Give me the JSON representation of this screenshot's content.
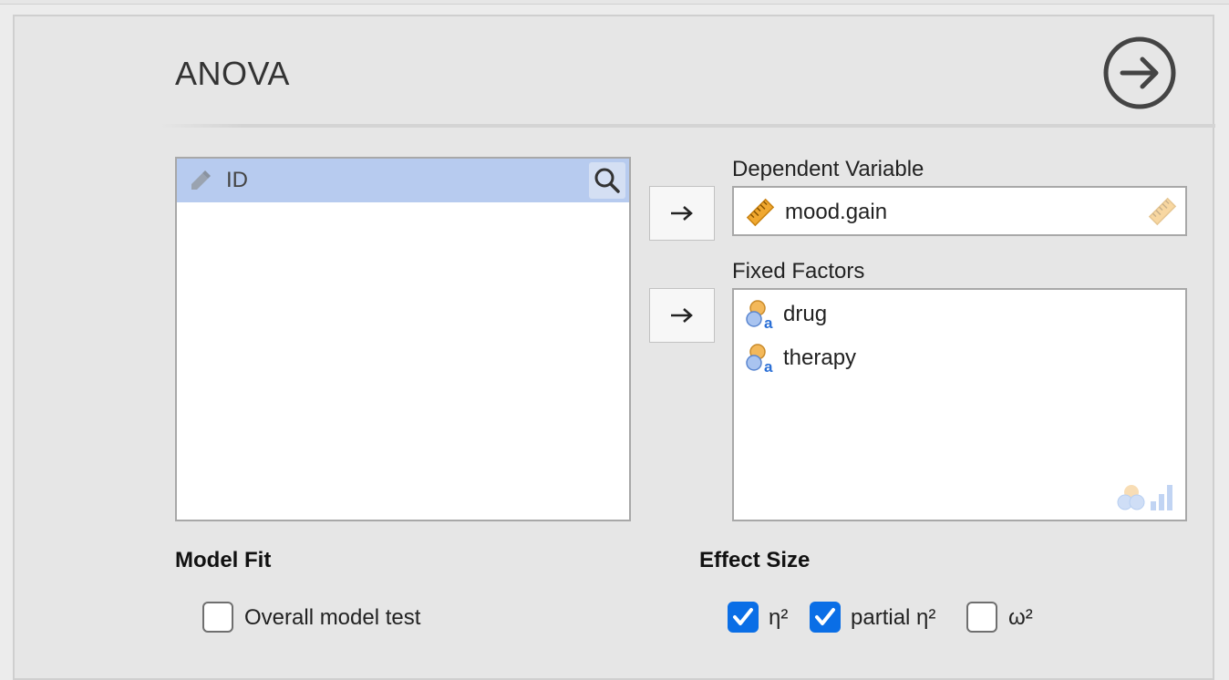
{
  "header": {
    "title": "ANOVA"
  },
  "run_button": {
    "icon": "arrow-right-circle-icon"
  },
  "source_list": {
    "items": [
      {
        "label": "ID",
        "icon": "nominal-id-icon",
        "selected": true
      }
    ],
    "search_icon": "search-icon"
  },
  "dependent_variable": {
    "label": "Dependent Variable",
    "items": [
      {
        "label": "mood.gain",
        "icon": "ruler-scale-icon"
      }
    ],
    "hint_icon": "ruler-scale-icon"
  },
  "fixed_factors": {
    "label": "Fixed Factors",
    "items": [
      {
        "label": "drug",
        "icon": "nominal-factor-icon"
      },
      {
        "label": "therapy",
        "icon": "nominal-factor-icon"
      }
    ],
    "hint_icon": "factor-types-icon"
  },
  "model_fit": {
    "heading": "Model Fit",
    "overall_model_test": {
      "label": "Overall model test",
      "checked": false
    }
  },
  "effect_size": {
    "heading": "Effect Size",
    "options": [
      {
        "label": "η²",
        "checked": true
      },
      {
        "label": "partial η²",
        "checked": true
      },
      {
        "label": "ω²",
        "checked": false
      }
    ]
  },
  "colors": {
    "accent": "#0a6ee6",
    "selection": "#b7cbef",
    "scale_icon": "#f0a830",
    "factor_orange": "#f3b85a",
    "factor_blue": "#7fa8e6"
  }
}
